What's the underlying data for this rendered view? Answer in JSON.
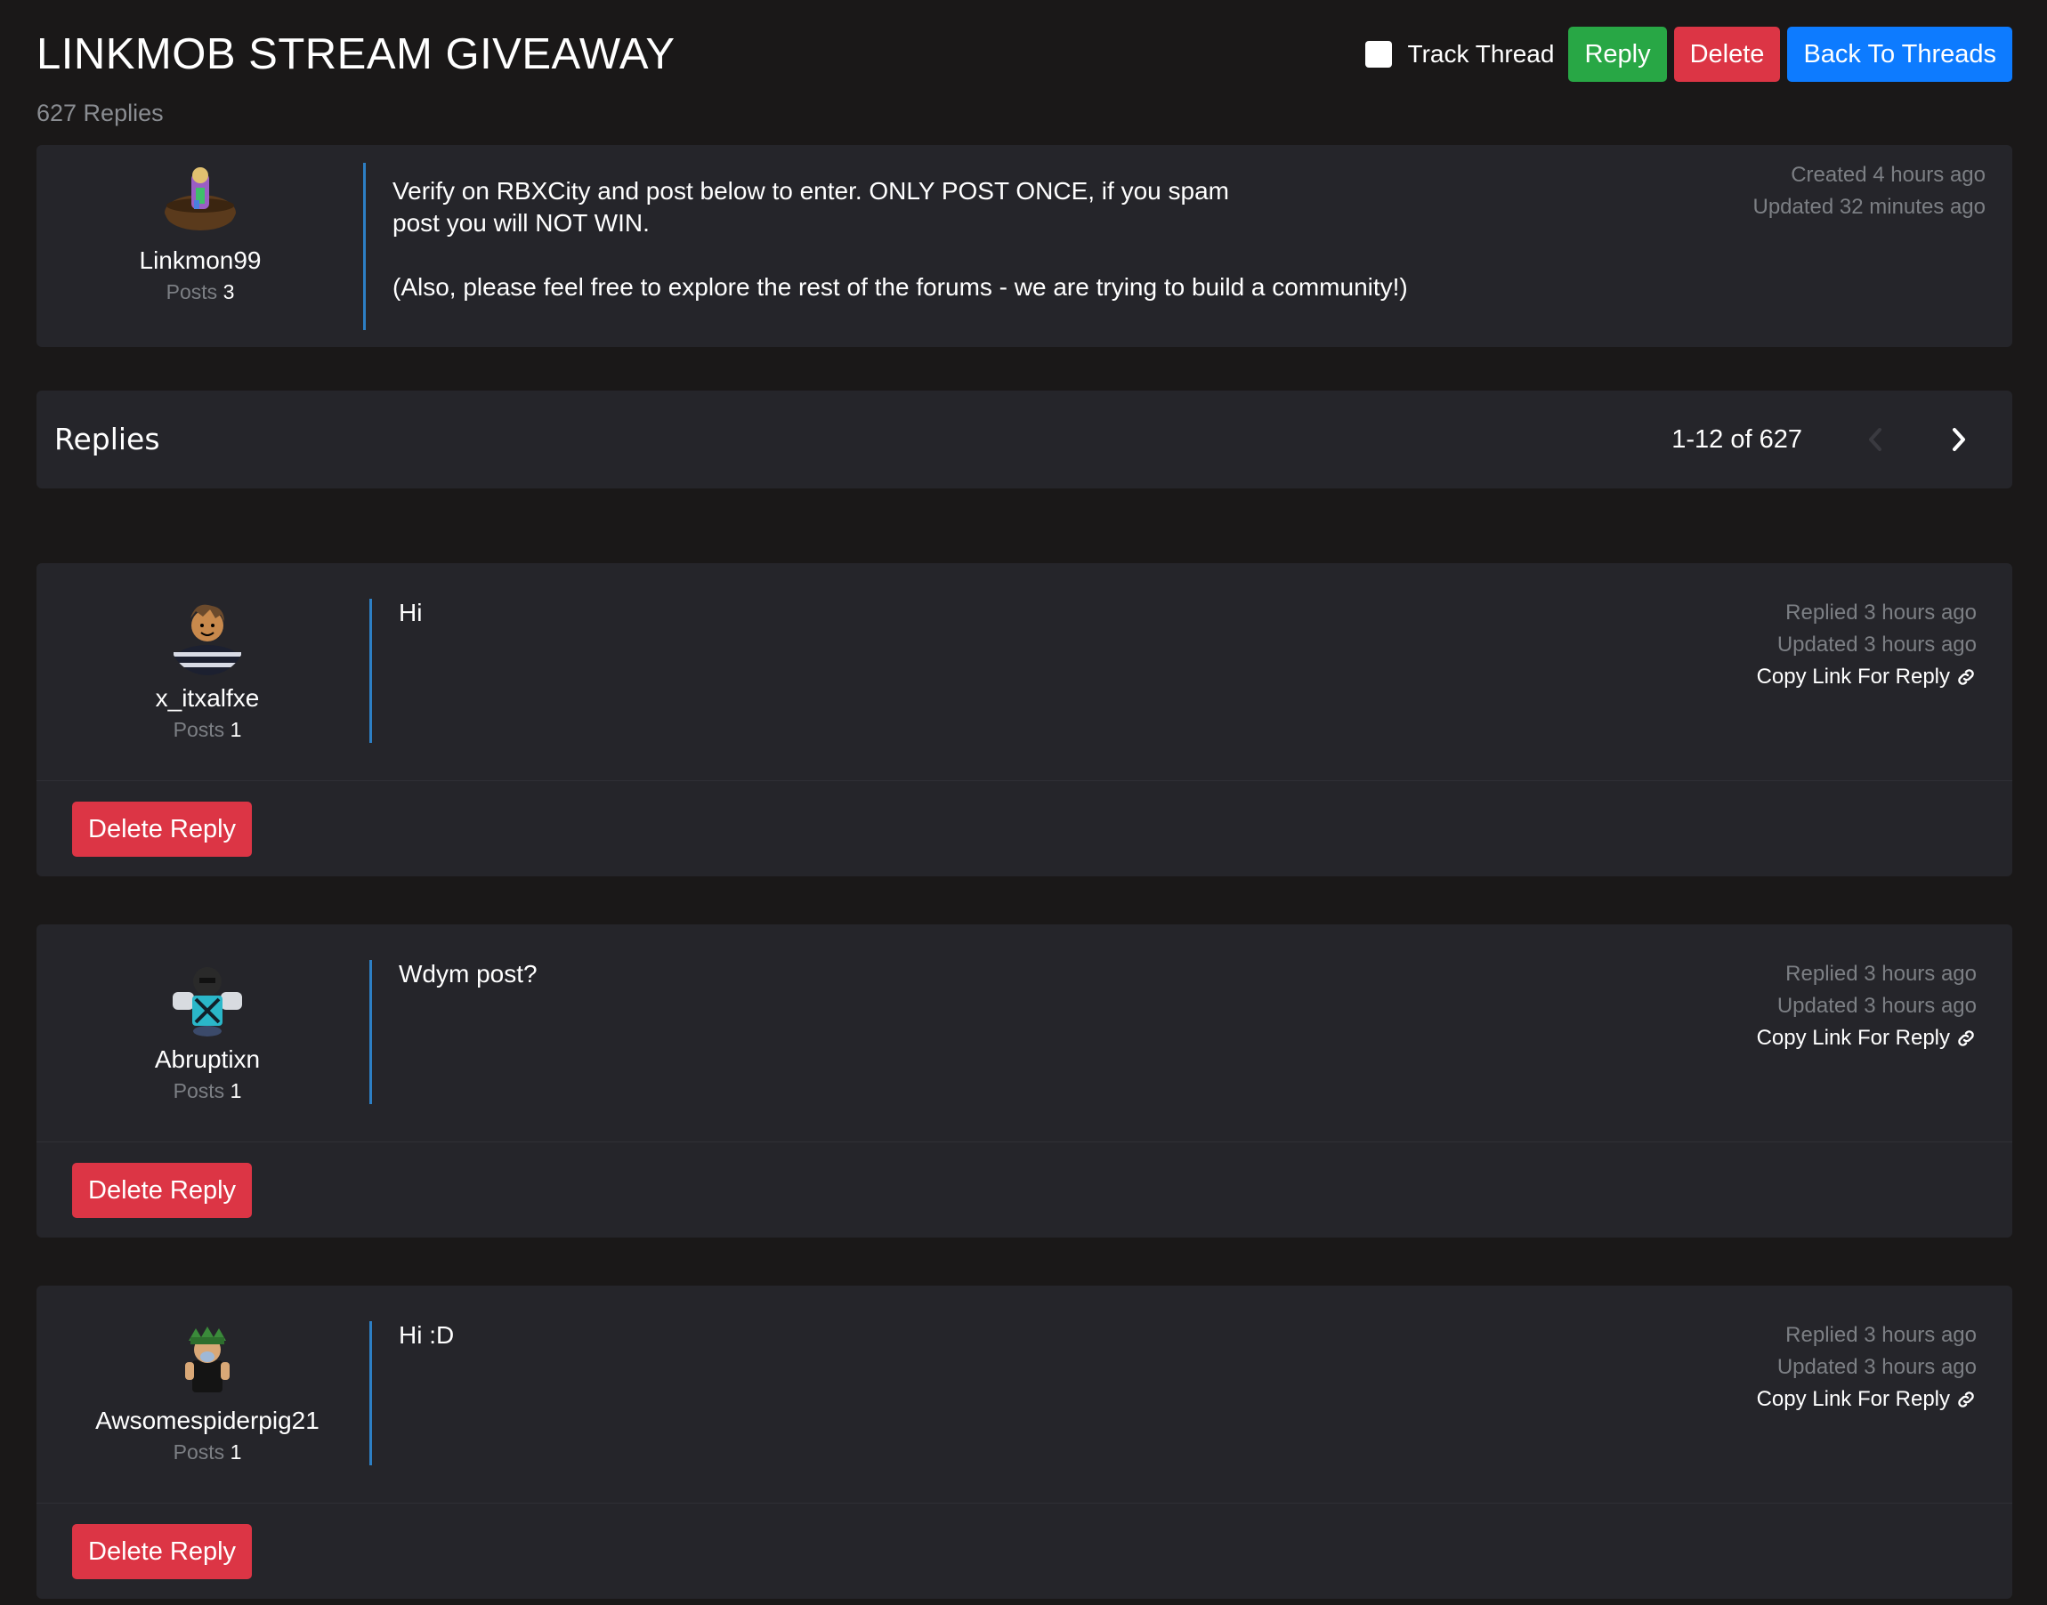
{
  "thread": {
    "title": "LINKMOB STREAM GIVEAWAY",
    "reply_count": "627 Replies",
    "track_label": "Track Thread",
    "reply_label": "Reply",
    "delete_label": "Delete",
    "back_label": "Back To Threads",
    "track_checked": false
  },
  "op": {
    "username": "Linkmon99",
    "posts_label": "Posts",
    "posts_count": "3",
    "body_line1": "Verify on RBXCity and post below to enter. ONLY POST ONCE, if you spam",
    "body_line2": "post you will NOT WIN.",
    "body_line3": "(Also, please feel free to explore the rest of the forums - we are trying to build a community!)",
    "created": "Created 4 hours ago",
    "updated": "Updated 32 minutes ago"
  },
  "replies_bar": {
    "title": "Replies",
    "range": "1-12 of 627",
    "prev_icon": "chevron-left-icon",
    "next_icon": "chevron-right-icon"
  },
  "replies": [
    {
      "username": "x_itxalfxe",
      "posts_label": "Posts",
      "posts_count": "1",
      "body": "Hi",
      "replied": "Replied 3 hours ago",
      "updated": "Updated 3 hours ago",
      "copy_link": "Copy Link For Reply",
      "delete_label": "Delete Reply"
    },
    {
      "username": "Abruptixn",
      "posts_label": "Posts",
      "posts_count": "1",
      "body": "Wdym post?",
      "replied": "Replied 3 hours ago",
      "updated": "Updated 3 hours ago",
      "copy_link": "Copy Link For Reply",
      "delete_label": "Delete Reply"
    },
    {
      "username": "Awsomespiderpig21",
      "posts_label": "Posts",
      "posts_count": "1",
      "body": "Hi :D",
      "replied": "Replied 3 hours ago",
      "updated": "Updated 3 hours ago",
      "copy_link": "Copy Link For Reply",
      "delete_label": "Delete Reply"
    }
  ],
  "colors": {
    "background": "#1a1818",
    "panel": "#25252a",
    "accent_divider": "#2d7fc4",
    "reply_button": "#28a745",
    "delete_button": "#dc3545",
    "back_button": "#0d7bff",
    "muted_text": "#7c7f84"
  }
}
